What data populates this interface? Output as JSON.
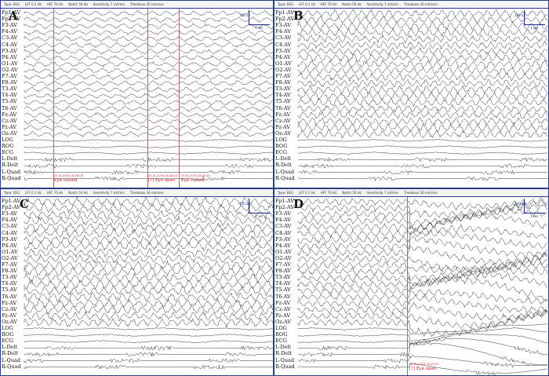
{
  "toolbar": {
    "type_label": "Type",
    "type_value": "EEG",
    "lff_label": "LFF",
    "lff_value": "0.1 Hz",
    "hff_label": "HFF",
    "hff_value": "70 Hz",
    "notch_label": "Notch",
    "notch_value": "50 Hz",
    "sensitivity_label": "Sensitivity",
    "sensitivity_value": "7 uV/mm",
    "timebase_label": "Timebase",
    "timebase_value": "30 mm/sec"
  },
  "channels": [
    "Fp1-AV",
    "Fp2-AV",
    "F3-AV",
    "F4-AV",
    "C3-AV",
    "C4-AV",
    "P3-AV",
    "P4-AV",
    "O1-AV",
    "O2-AV",
    "F7-AV",
    "F8-AV",
    "T3-AV",
    "T4-AV",
    "T5-AV",
    "T6-AV",
    "Fz-AV",
    "Cz-AV",
    "Pz-AV",
    "Oz-AV",
    "LOG",
    "ROG",
    "ECG",
    "L-Delt",
    "R-Delt",
    "L-Quad",
    "R-Quad"
  ],
  "scale": {
    "amplitude": "100 uV",
    "time": "1 sec"
  },
  "panels": {
    "A": {
      "letter": "A",
      "events": [
        {
          "time": "25.01.2016 16:28:08",
          "text": "Eye closed"
        },
        {
          "time": "25.01.2016 16:28:10",
          "text": "[?] Eye open"
        },
        {
          "time": "25.01.2016 16:28:15",
          "text": "Eye closed"
        }
      ]
    },
    "B": {
      "letter": "B",
      "events": []
    },
    "C": {
      "letter": "C",
      "events": []
    },
    "D": {
      "letter": "D",
      "events": [
        {
          "time": "25.01.2016 16:29:59",
          "text": "[?] Eye open"
        }
      ]
    }
  },
  "colors": {
    "frame": "#2a3c8c",
    "trace": "#1a1a1a",
    "event_line": "#e05070",
    "event_text": "#d0203a"
  }
}
